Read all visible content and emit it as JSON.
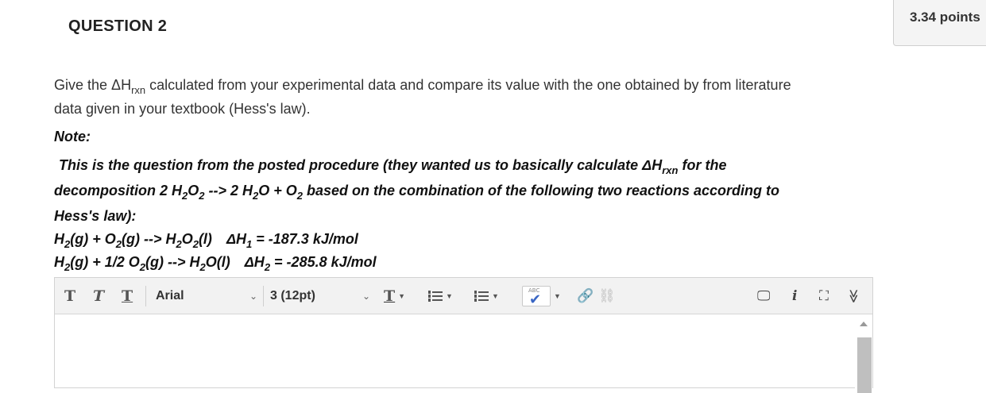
{
  "question": {
    "title": "QUESTION 2",
    "points": "3.34 points"
  },
  "prompt": {
    "intro_line1_a": "Give the ",
    "delta_h": "ΔH",
    "rxn": "rxn",
    "intro_line1_b": " calculated from your experimental data and compare its value with the one obtained by from literature",
    "intro_line2": "data given in your textbook (Hess's law).",
    "note": "Note:",
    "proc_line1_a": "This is the question from the posted procedure (they wanted us to basically calculate ",
    "proc_line1_b": " for the",
    "proc_line2_a": "decomposition 2 H",
    "proc_line2_b": "O",
    "proc_line2_c": " --> 2 H",
    "proc_line2_d": "O + O",
    "proc_line2_e": " based on the combination of the following two reactions according to",
    "proc_line3": "Hess's law):",
    "sub_2": "2",
    "sub_1": "1",
    "rx1_a": "H",
    "rx1_b": "(g) + O",
    "rx1_c": "(g) --> H",
    "rx1_d": "O",
    "rx1_e": "(l)",
    "rx1_dh": "ΔH",
    "rx1_val": " = -187.3 kJ/mol",
    "rx2_a": "H",
    "rx2_b": "(g) + 1/2 O",
    "rx2_c": "(g) --> H",
    "rx2_d": "O(l)",
    "rx2_dh": "ΔH",
    "rx2_val": " = -285.8 kJ/mol"
  },
  "toolbar": {
    "bold_glyph": "T",
    "italic_glyph": "T",
    "underline_glyph": "T",
    "font_family": "Arial",
    "font_size": "3 (12pt)",
    "text_color_glyph": "T",
    "spell_label": "ABC",
    "check_glyph": "✔",
    "link_glyph": "🔗",
    "unlink_glyph": "⛓",
    "preview_glyph": "🖵",
    "info_glyph": "i",
    "fullscreen_glyph": "⛶",
    "collapse_glyph": "≫"
  }
}
